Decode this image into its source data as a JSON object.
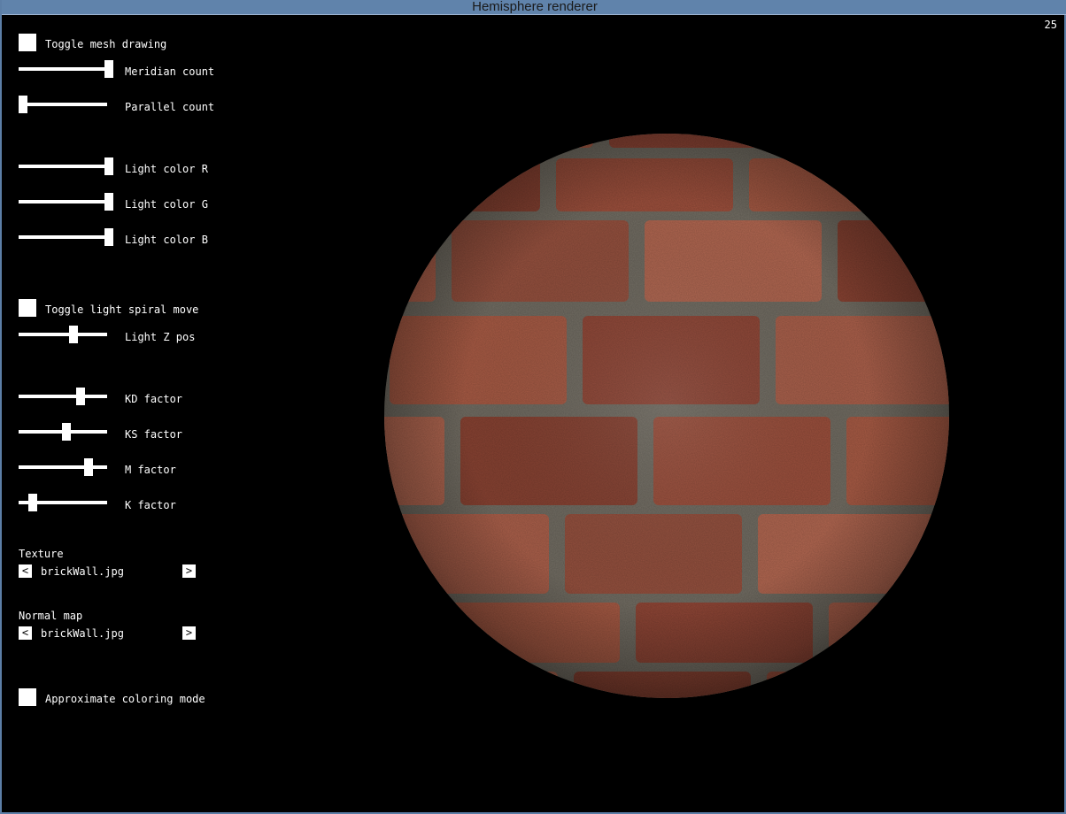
{
  "window": {
    "title": "Hemisphere renderer"
  },
  "fps": "25",
  "controls": {
    "toggle_mesh": {
      "label": "Toggle mesh drawing",
      "checked": false
    },
    "meridian": {
      "label": "Meridian count",
      "value": 1.0
    },
    "parallel": {
      "label": "Parallel count",
      "value": 0.0
    },
    "light_r": {
      "label": "Light color R",
      "value": 1.0
    },
    "light_g": {
      "label": "Light color G",
      "value": 1.0
    },
    "light_b": {
      "label": "Light color B",
      "value": 1.0
    },
    "toggle_spiral": {
      "label": "Toggle light spiral move",
      "checked": false
    },
    "light_z": {
      "label": "Light Z pos",
      "value": 0.59
    },
    "kd": {
      "label": "KD factor",
      "value": 0.67
    },
    "ks": {
      "label": "KS factor",
      "value": 0.5
    },
    "m": {
      "label": "M factor",
      "value": 0.76
    },
    "k": {
      "label": "K factor",
      "value": 0.11
    },
    "texture": {
      "label": "Texture",
      "file": "brickWall.jpg",
      "prev": "<",
      "next": ">"
    },
    "normal_map": {
      "label": "Normal map",
      "file": "brickWall.jpg",
      "prev": "<",
      "next": ">"
    },
    "approx": {
      "label": "Approximate coloring mode",
      "checked": false
    }
  },
  "colors": {
    "titlebar": "#6083ab",
    "fps": "#d41818",
    "brick": "#9a4e3c",
    "mortar": "#6e6a60"
  }
}
